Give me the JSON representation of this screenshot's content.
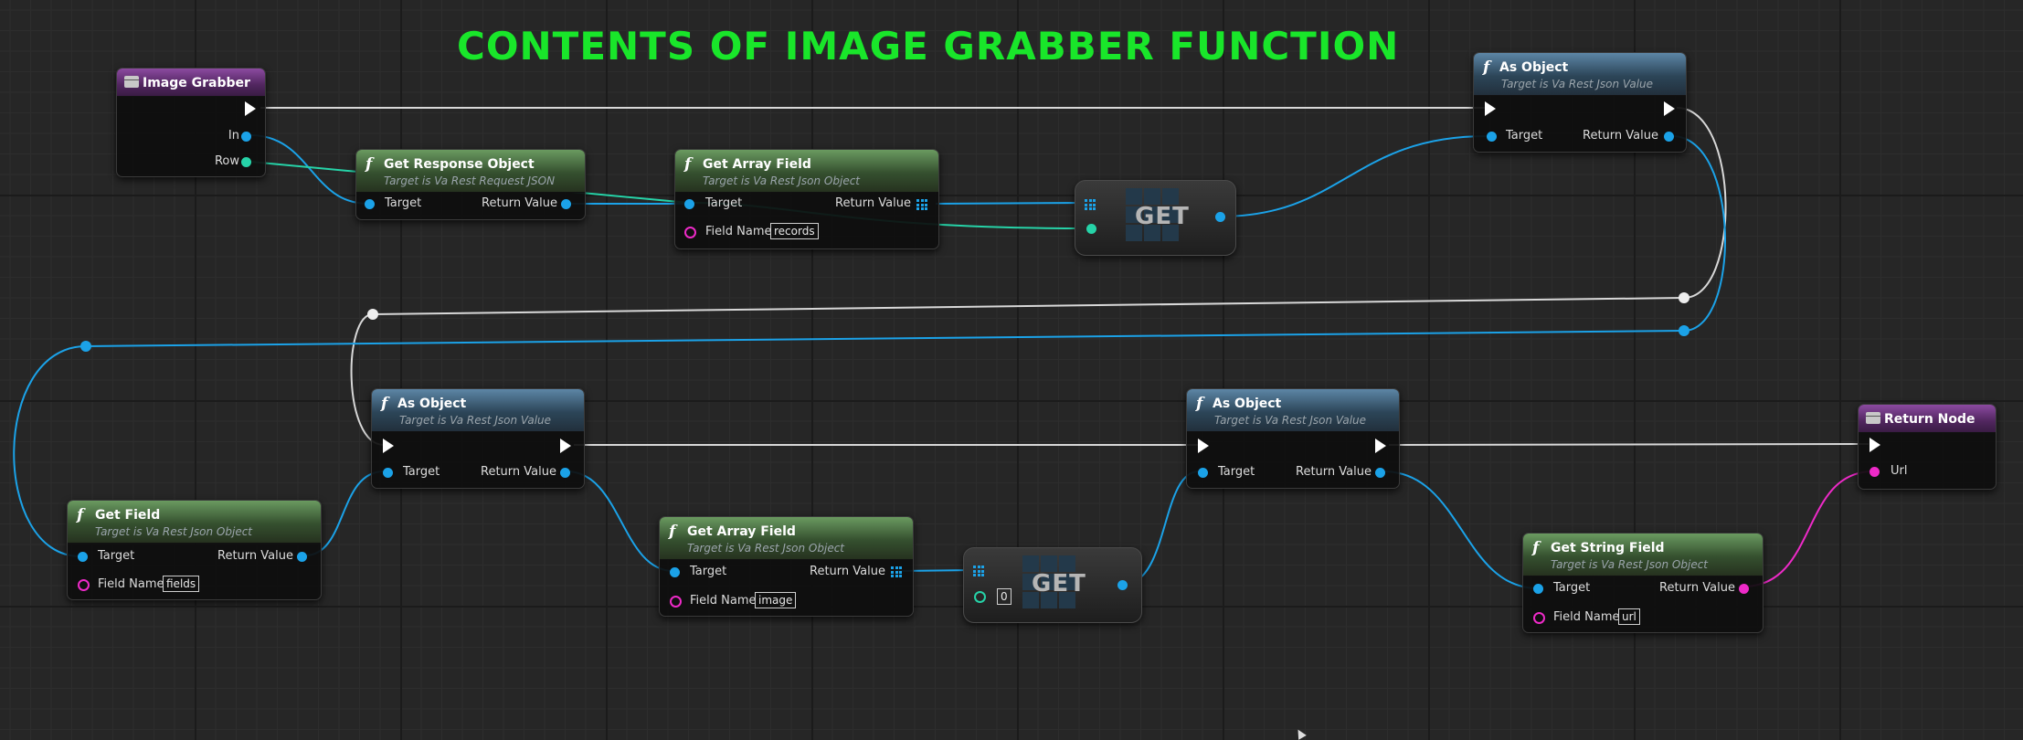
{
  "graph_title": "CONTENTS OF IMAGE GRABBER FUNCTION",
  "colors": {
    "exec": "#ffffff",
    "object": "#1ba2e8",
    "struct": "#26d3a8",
    "string": "#ee2ac8",
    "title": "#19e62a"
  },
  "icons": {
    "function": "function-icon",
    "entry": "event-icon",
    "array": "array-grid-icon",
    "exec": "exec-pin-icon"
  },
  "function_glyph": "f",
  "entry": {
    "title": "Image Grabber",
    "pin_in": "In",
    "pin_row": "Row"
  },
  "get_response": {
    "title": "Get Response Object",
    "subtitle": "Target is Va Rest Request JSON",
    "target": "Target",
    "return_value": "Return Value"
  },
  "get_array_1": {
    "title": "Get Array Field",
    "subtitle": "Target is Va Rest Json Object",
    "target": "Target",
    "return_value": "Return Value",
    "field_name_label": "Field Name",
    "field_name_value": "records"
  },
  "get_1": {
    "label": "GET"
  },
  "as_object_1": {
    "title": "As Object",
    "subtitle": "Target is Va Rest Json Value",
    "target": "Target",
    "return_value": "Return Value"
  },
  "get_field": {
    "title": "Get Field",
    "subtitle": "Target is Va Rest Json Object",
    "target": "Target",
    "return_value": "Return Value",
    "field_name_label": "Field Name",
    "field_name_value": "fields"
  },
  "as_object_2": {
    "title": "As Object",
    "subtitle": "Target is Va Rest Json Value",
    "target": "Target",
    "return_value": "Return Value"
  },
  "get_array_2": {
    "title": "Get Array Field",
    "subtitle": "Target is Va Rest Json Object",
    "target": "Target",
    "return_value": "Return Value",
    "field_name_label": "Field Name",
    "field_name_value": "image"
  },
  "get_2": {
    "label": "GET",
    "index_value": "0"
  },
  "as_object_3": {
    "title": "As Object",
    "subtitle": "Target is Va Rest Json Value",
    "target": "Target",
    "return_value": "Return Value"
  },
  "get_string": {
    "title": "Get String Field",
    "subtitle": "Target is Va Rest Json Object",
    "target": "Target",
    "return_value": "Return Value",
    "field_name_label": "Field Name",
    "field_name_value": "url"
  },
  "return_node": {
    "title": "Return Node",
    "pin_url": "Url"
  }
}
